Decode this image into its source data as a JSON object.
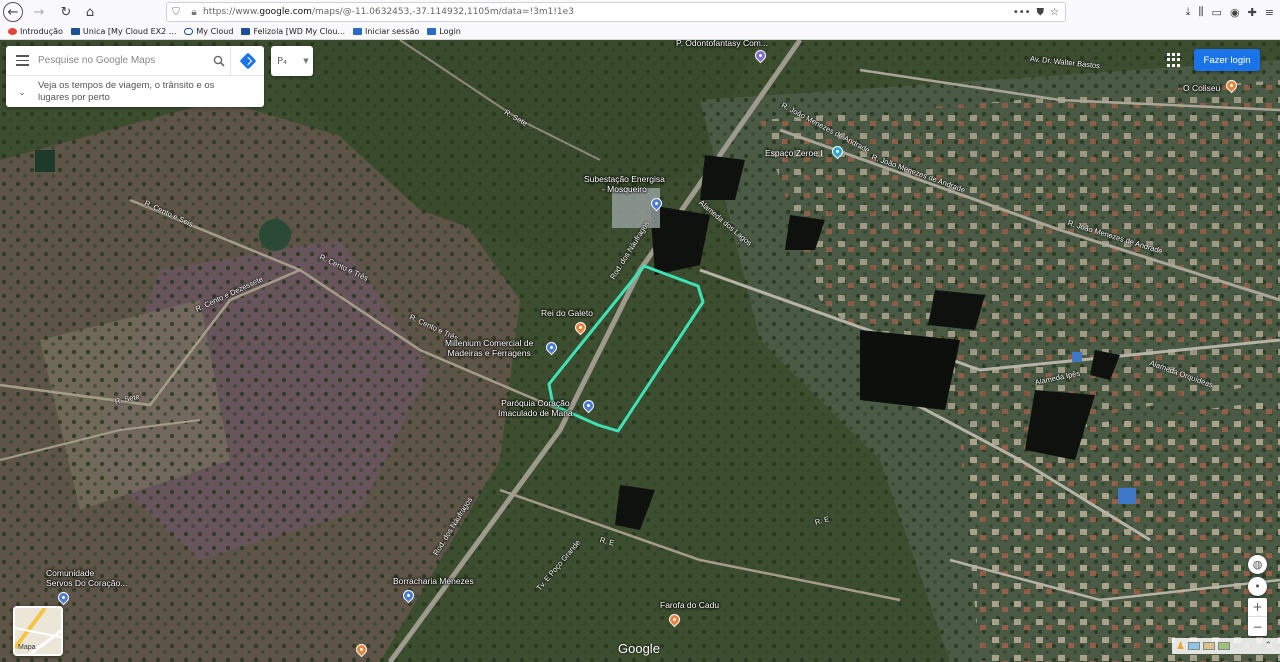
{
  "browser": {
    "url_prefix": "https://www.",
    "url_domain": "google.com",
    "url_rest": "/maps/@-11.0632453,-37.114932,1105m/data=!3m1!1e3",
    "bookmarks": [
      {
        "label": "Introdução",
        "color": "#e0463a"
      },
      {
        "label": "Unica [My Cloud EX2 ...",
        "color": "#1c4f96"
      },
      {
        "label": "My Cloud",
        "color": "#1c4f96"
      },
      {
        "label": "Felizola [WD My Clou...",
        "color": "#1c4f96"
      },
      {
        "label": "Iniciar sessão",
        "color": "#2a6ac4"
      },
      {
        "label": "Login",
        "color": "#2a6ac4"
      }
    ]
  },
  "search": {
    "placeholder": "Pesquise no Google Maps",
    "info_text": "Veja os tempos de viagem, o trânsito e os lugares por perto",
    "layer_chip": "P₄"
  },
  "top_right": {
    "login_label": "Fazer login"
  },
  "map_type_label": "Mapa",
  "google_label": "Google",
  "places": {
    "odonto": "P. Odontofantasy Com...",
    "coliseu": "O Coliseu",
    "espaco": "Espaço Zeroe I",
    "subestacao": "Subestação Energisa\n- Mosqueiro",
    "rei_galeto": "Rei do Galeto",
    "millenium": "Millenium Comercial de\nMadeiras e Ferragens",
    "paroquia": "Paróquia Coração\nImaculado de Maria",
    "comunidade": "Comunidade\nServos Do Coração...",
    "borracharia": "Borracharia Menezes",
    "farofa": "Farofa do Cadu"
  },
  "roads": {
    "rod_naufragos_1": "Rod. dos Náufragos",
    "rod_naufragos_2": "Rod. dos Náufragos",
    "r_sete_1": "R. Sete",
    "r_sete_2": "R. Sete",
    "r_cento_tres_1": "R. Cento e Três",
    "r_cento_tres_2": "R. Cento e Três",
    "r_cento_seis": "R. Cento e Seis",
    "r_cento_desessete": "R. Cento e Dezessete",
    "av_walter": "Av. Dr. Walter Bastos",
    "r_joao_1": "R. João Menezes de Andrade",
    "r_joao_2": "R. João Menezes de Andrade",
    "r_joao_3": "R. João Menezes de Andrade",
    "alameda_lagos": "Alameda dos Lagos",
    "alameda_ipes": "Alameda Ipês",
    "alameda_orquideas": "Alameda Orquídeas",
    "r_e_1": "R. E",
    "r_e_2": "R. E",
    "tv_poco": "Tv. E Poço Grande"
  },
  "colors": {
    "polygon": "#3ee2b4",
    "login_blue": "#1a73e8",
    "pin_blue": "#4a7bd3",
    "pin_orange": "#e8833a",
    "pin_purple": "#7b6fd4"
  }
}
